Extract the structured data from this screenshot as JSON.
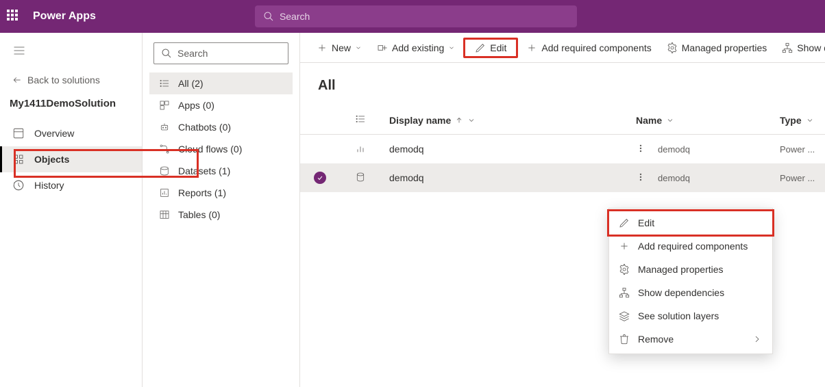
{
  "brand": "Power Apps",
  "top_search_placeholder": "Search",
  "leftnav": {
    "back": "Back to solutions",
    "solution": "My1411DemoSolution",
    "items": [
      {
        "label": "Overview"
      },
      {
        "label": "Objects"
      },
      {
        "label": "History"
      }
    ]
  },
  "tree_search_placeholder": "Search",
  "tree": [
    {
      "label": "All  (2)"
    },
    {
      "label": "Apps  (0)"
    },
    {
      "label": "Chatbots  (0)"
    },
    {
      "label": "Cloud flows  (0)"
    },
    {
      "label": "Datasets  (1)"
    },
    {
      "label": "Reports  (1)"
    },
    {
      "label": "Tables  (0)"
    }
  ],
  "cmdbar": {
    "new": "New",
    "add_existing": "Add existing",
    "edit": "Edit",
    "add_required": "Add required components",
    "managed": "Managed properties",
    "show_dep": "Show de"
  },
  "page_title": "All",
  "columns": {
    "display_name": "Display name",
    "name": "Name",
    "type": "Type"
  },
  "rows": [
    {
      "display": "demodq",
      "name": "demodq",
      "type": "Power ..."
    },
    {
      "display": "demodq",
      "name": "demodq",
      "type": "Power ..."
    }
  ],
  "ctx": {
    "edit": "Edit",
    "add_required": "Add required components",
    "managed": "Managed properties",
    "show_dep": "Show dependencies",
    "layers": "See solution layers",
    "remove": "Remove"
  }
}
